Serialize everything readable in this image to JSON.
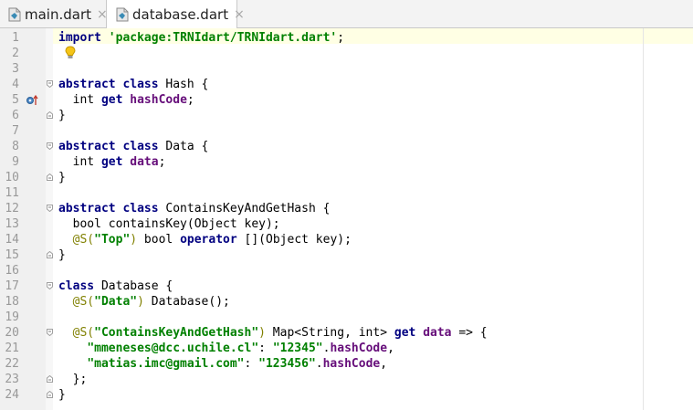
{
  "tabs": [
    {
      "label": "main.dart",
      "active": false,
      "icon": "dart-file-icon"
    },
    {
      "label": "database.dart",
      "active": true,
      "icon": "dart-file-icon"
    }
  ],
  "tab_close_glyph": "×",
  "colors": {
    "keyword": "#000080",
    "string": "#008000",
    "member": "#660e7a",
    "annotation": "#808000",
    "current_line": "#ffffe4"
  },
  "lines": [
    {
      "n": "1",
      "tokens": [
        [
          "kw",
          "import"
        ],
        [
          "",
          " "
        ],
        [
          "str",
          "'package:TRNIdart/TRNIdart.dart'"
        ],
        [
          "",
          ";"
        ]
      ]
    },
    {
      "n": "2",
      "tokens": []
    },
    {
      "n": "3",
      "tokens": []
    },
    {
      "n": "4",
      "tokens": [
        [
          "kw",
          "abstract class"
        ],
        [
          "",
          " Hash {"
        ]
      ]
    },
    {
      "n": "5",
      "tokens": [
        [
          "",
          "  int "
        ],
        [
          "kw",
          "get"
        ],
        [
          "",
          " "
        ],
        [
          "mem",
          "hashCode"
        ],
        [
          "",
          ";"
        ]
      ]
    },
    {
      "n": "6",
      "tokens": [
        [
          "",
          "}"
        ]
      ]
    },
    {
      "n": "7",
      "tokens": []
    },
    {
      "n": "8",
      "tokens": [
        [
          "kw",
          "abstract class"
        ],
        [
          "",
          " Data {"
        ]
      ]
    },
    {
      "n": "9",
      "tokens": [
        [
          "",
          "  int "
        ],
        [
          "kw",
          "get"
        ],
        [
          "",
          " "
        ],
        [
          "mem",
          "data"
        ],
        [
          "",
          ";"
        ]
      ]
    },
    {
      "n": "10",
      "tokens": [
        [
          "",
          "}"
        ]
      ]
    },
    {
      "n": "11",
      "tokens": []
    },
    {
      "n": "12",
      "tokens": [
        [
          "kw",
          "abstract class"
        ],
        [
          "",
          " ContainsKeyAndGetHash {"
        ]
      ]
    },
    {
      "n": "13",
      "tokens": [
        [
          "",
          "  bool containsKey(Object key);"
        ]
      ]
    },
    {
      "n": "14",
      "tokens": [
        [
          "",
          "  "
        ],
        [
          "ann",
          "@S("
        ],
        [
          "str",
          "\"Top\""
        ],
        [
          "ann",
          ")"
        ],
        [
          "",
          " bool "
        ],
        [
          "kw",
          "operator"
        ],
        [
          "",
          " [](Object key);"
        ]
      ]
    },
    {
      "n": "15",
      "tokens": [
        [
          "",
          "}"
        ]
      ]
    },
    {
      "n": "16",
      "tokens": []
    },
    {
      "n": "17",
      "tokens": [
        [
          "kw",
          "class"
        ],
        [
          "",
          " Database {"
        ]
      ]
    },
    {
      "n": "18",
      "tokens": [
        [
          "",
          "  "
        ],
        [
          "ann",
          "@S("
        ],
        [
          "str",
          "\"Data\""
        ],
        [
          "ann",
          ")"
        ],
        [
          "",
          " Database();"
        ]
      ]
    },
    {
      "n": "19",
      "tokens": []
    },
    {
      "n": "20",
      "tokens": [
        [
          "",
          "  "
        ],
        [
          "ann",
          "@S("
        ],
        [
          "str",
          "\"ContainsKeyAndGetHash\""
        ],
        [
          "ann",
          ")"
        ],
        [
          "",
          " Map<String, int> "
        ],
        [
          "kw",
          "get"
        ],
        [
          "",
          " "
        ],
        [
          "mem",
          "data"
        ],
        [
          "",
          " => {"
        ]
      ]
    },
    {
      "n": "21",
      "tokens": [
        [
          "",
          "    "
        ],
        [
          "str",
          "\"mmeneses@dcc.uchile.cl\""
        ],
        [
          "",
          ": "
        ],
        [
          "str",
          "\"12345\""
        ],
        [
          "",
          "."
        ],
        [
          "mem",
          "hashCode"
        ],
        [
          "",
          ","
        ]
      ]
    },
    {
      "n": "22",
      "tokens": [
        [
          "",
          "    "
        ],
        [
          "str",
          "\"matias.imc@gmail.com\""
        ],
        [
          "",
          ": "
        ],
        [
          "str",
          "\"123456\""
        ],
        [
          "",
          "."
        ],
        [
          "mem",
          "hashCode"
        ],
        [
          "",
          ","
        ]
      ]
    },
    {
      "n": "23",
      "tokens": [
        [
          "",
          "  };"
        ]
      ]
    },
    {
      "n": "24",
      "tokens": [
        [
          "",
          "}"
        ]
      ]
    }
  ],
  "folds": [
    {
      "line": 4,
      "kind": "open"
    },
    {
      "line": 6,
      "kind": "close"
    },
    {
      "line": 8,
      "kind": "open"
    },
    {
      "line": 10,
      "kind": "close"
    },
    {
      "line": 12,
      "kind": "open"
    },
    {
      "line": 15,
      "kind": "close"
    },
    {
      "line": 17,
      "kind": "open"
    },
    {
      "line": 20,
      "kind": "open"
    },
    {
      "line": 23,
      "kind": "close"
    },
    {
      "line": 24,
      "kind": "close"
    }
  ],
  "gutter_markers": [
    {
      "line": 5,
      "icon": "override-marker-icon"
    }
  ],
  "intention_bulb_line": 2
}
